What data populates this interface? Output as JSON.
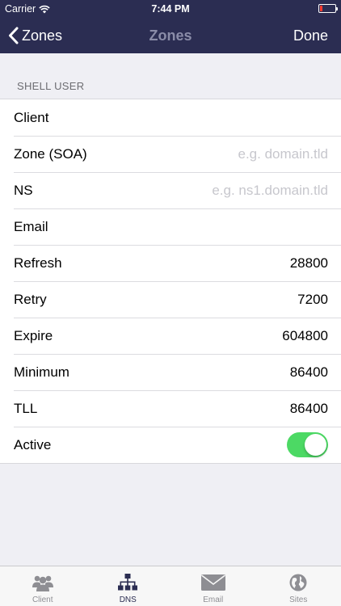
{
  "status_bar": {
    "carrier": "Carrier",
    "time": "7:44 PM"
  },
  "nav": {
    "back_label": "Zones",
    "title": "Zones",
    "done_label": "Done"
  },
  "section": {
    "header": "SHELL USER"
  },
  "rows": [
    {
      "label": "Client",
      "value": ""
    },
    {
      "label": "Zone (SOA)",
      "placeholder": "e.g. domain.tld"
    },
    {
      "label": "NS",
      "placeholder": "e.g. ns1.domain.tld"
    },
    {
      "label": "Email",
      "value": ""
    },
    {
      "label": "Refresh",
      "value": "28800"
    },
    {
      "label": "Retry",
      "value": "7200"
    },
    {
      "label": "Expire",
      "value": "604800"
    },
    {
      "label": "Minimum",
      "value": "86400"
    },
    {
      "label": "TLL",
      "value": "86400"
    },
    {
      "label": "Active",
      "toggle_on": true
    }
  ],
  "tabbar": {
    "tabs": [
      {
        "label": "Client",
        "icon": "users-icon"
      },
      {
        "label": "DNS",
        "icon": "network-icon"
      },
      {
        "label": "Email",
        "icon": "envelope-icon"
      },
      {
        "label": "Sites",
        "icon": "globe-icon"
      }
    ],
    "active_index": 1
  },
  "colors": {
    "nav_bg": "#2b2d52",
    "toggle_on": "#4cd964",
    "background": "#efeff4",
    "tab_active": "#2b2d52",
    "tab_inactive": "#8e8e93"
  }
}
